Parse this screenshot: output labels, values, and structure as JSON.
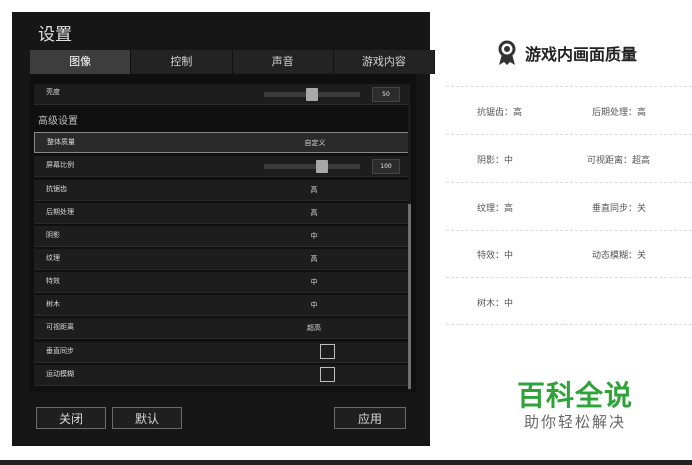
{
  "window": {
    "title": "设置",
    "tabs": [
      {
        "label": "图像",
        "active": true
      },
      {
        "label": "控制",
        "active": false
      },
      {
        "label": "声音",
        "active": false
      },
      {
        "label": "游戏内容",
        "active": false
      }
    ],
    "brightness": {
      "label": "亮度",
      "value": "50",
      "level": 0.5
    },
    "section_title": "高级设置",
    "overall_quality": {
      "label": "整体质量",
      "value": "自定义"
    },
    "screen_ratio": {
      "label": "屏幕比例",
      "value": "100",
      "level": 0.6
    },
    "options": [
      {
        "label": "抗锯齿",
        "value": "高"
      },
      {
        "label": "后期处理",
        "value": "高"
      },
      {
        "label": "阴影",
        "value": "中"
      },
      {
        "label": "纹理",
        "value": "高"
      },
      {
        "label": "特效",
        "value": "中"
      },
      {
        "label": "树木",
        "value": "中"
      },
      {
        "label": "可视距离",
        "value": "超高"
      }
    ],
    "checkboxes": [
      {
        "label": "垂直同步",
        "checked": false
      },
      {
        "label": "运动模糊",
        "checked": false
      }
    ],
    "buttons": {
      "close": "关闭",
      "default": "默认",
      "apply": "应用"
    }
  },
  "card": {
    "title": "游戏内画面质量",
    "icon": "medal-icon",
    "items": [
      "抗锯齿：高",
      "后期处理：高",
      "阴影：中",
      "可视距离：超高",
      "纹理：高",
      "垂直同步：关",
      "特效：中",
      "动态模糊：关",
      "树木：中"
    ]
  },
  "brand": {
    "name": "百科全说",
    "tagline": "助你轻松解决",
    "color": "#2fa33a"
  }
}
